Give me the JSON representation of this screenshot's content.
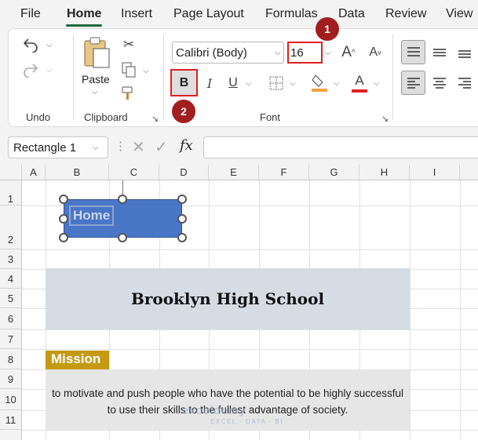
{
  "menu": {
    "tabs": [
      "File",
      "Home",
      "Insert",
      "Page Layout",
      "Formulas",
      "Data",
      "Review",
      "View"
    ]
  },
  "ribbon": {
    "undo_label": "Undo",
    "clipboard": {
      "paste_label": "Paste",
      "group_label": "Clipboard"
    },
    "font": {
      "family": "Calibri (Body)",
      "size": "16",
      "bold": "B",
      "italic": "I",
      "underline": "U",
      "grow": "A",
      "shrink": "A",
      "color_letter": "A",
      "group_label": "Font",
      "fill_color": "#f4a040",
      "font_color": "#e02020"
    }
  },
  "annotations": {
    "badge1": "1",
    "badge2": "2"
  },
  "formula_bar": {
    "name_box": "Rectangle 1",
    "fx": "fx",
    "formula": ""
  },
  "sheet": {
    "columns": [
      "A",
      "B",
      "C",
      "D",
      "E",
      "F",
      "G",
      "H",
      "I"
    ],
    "rows": [
      "1",
      "2",
      "3",
      "4",
      "5",
      "6",
      "7",
      "8",
      "9",
      "10",
      "11"
    ],
    "shape_text": "Home",
    "title": "Brooklyn  High School",
    "mission_header": "Mission",
    "mission_line1": "to motivate and push people who have the potential to be highly successful",
    "mission_line2": "to use their skills to the fullest advantage of society."
  },
  "watermark": {
    "name": "exceldemy",
    "tagline": "EXCEL · DATA · BI"
  },
  "colors": {
    "title_band": "#d5dce3",
    "mission_header": "#c49a13",
    "mission_band": "#e6e6e6",
    "shape_fill": "#4a76c8",
    "highlight_border": "#e02020",
    "badge": "#a21d1d"
  }
}
